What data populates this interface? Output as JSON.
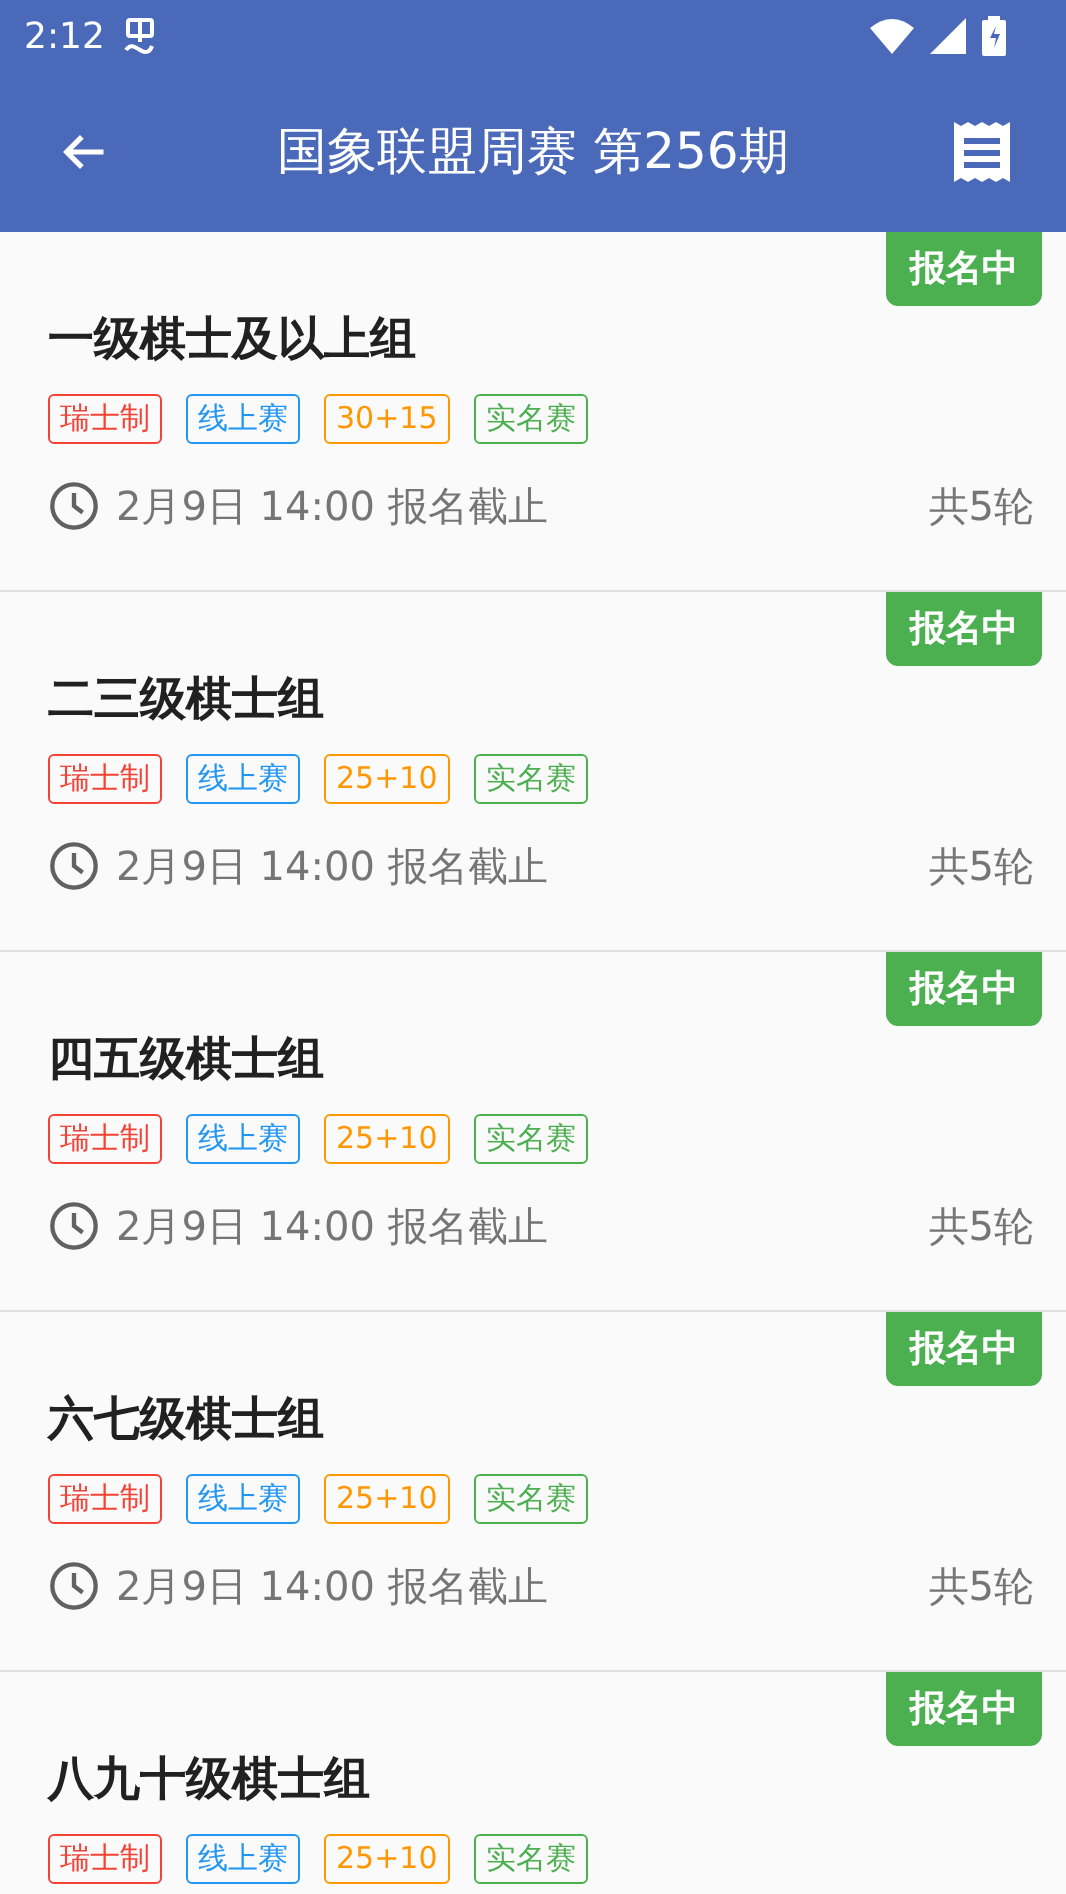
{
  "status_bar": {
    "time": "2:12"
  },
  "app_bar": {
    "title": "国象联盟周赛 第256期"
  },
  "groups": [
    {
      "status": "报名中",
      "title": "一级棋士及以上组",
      "tags": [
        {
          "label": "瑞士制",
          "color": "#f44336"
        },
        {
          "label": "线上赛",
          "color": "#2196f3"
        },
        {
          "label": "30+15",
          "color": "#ff9800"
        },
        {
          "label": "实名赛",
          "color": "#4caf50"
        }
      ],
      "deadline": "2月9日 14:00 报名截止",
      "rounds": "共5轮"
    },
    {
      "status": "报名中",
      "title": "二三级棋士组",
      "tags": [
        {
          "label": "瑞士制",
          "color": "#f44336"
        },
        {
          "label": "线上赛",
          "color": "#2196f3"
        },
        {
          "label": "25+10",
          "color": "#ff9800"
        },
        {
          "label": "实名赛",
          "color": "#4caf50"
        }
      ],
      "deadline": "2月9日 14:00 报名截止",
      "rounds": "共5轮"
    },
    {
      "status": "报名中",
      "title": "四五级棋士组",
      "tags": [
        {
          "label": "瑞士制",
          "color": "#f44336"
        },
        {
          "label": "线上赛",
          "color": "#2196f3"
        },
        {
          "label": "25+10",
          "color": "#ff9800"
        },
        {
          "label": "实名赛",
          "color": "#4caf50"
        }
      ],
      "deadline": "2月9日 14:00 报名截止",
      "rounds": "共5轮"
    },
    {
      "status": "报名中",
      "title": "六七级棋士组",
      "tags": [
        {
          "label": "瑞士制",
          "color": "#f44336"
        },
        {
          "label": "线上赛",
          "color": "#2196f3"
        },
        {
          "label": "25+10",
          "color": "#ff9800"
        },
        {
          "label": "实名赛",
          "color": "#4caf50"
        }
      ],
      "deadline": "2月9日 14:00 报名截止",
      "rounds": "共5轮"
    },
    {
      "status": "报名中",
      "title": "八九十级棋士组",
      "tags": [
        {
          "label": "瑞士制",
          "color": "#f44336"
        },
        {
          "label": "线上赛",
          "color": "#2196f3"
        },
        {
          "label": "25+10",
          "color": "#ff9800"
        },
        {
          "label": "实名赛",
          "color": "#4caf50"
        }
      ]
    }
  ]
}
